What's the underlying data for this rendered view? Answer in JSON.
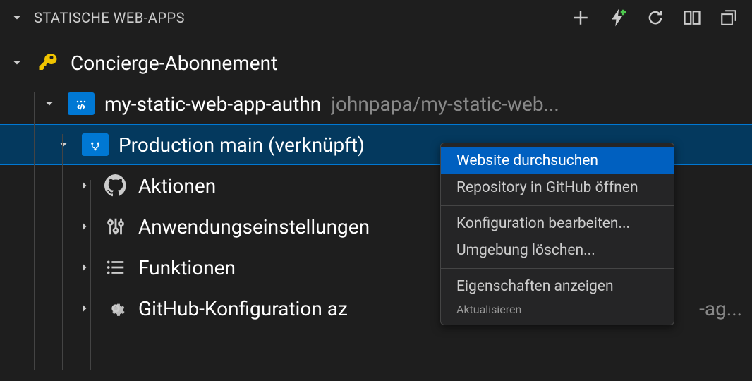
{
  "header": {
    "title": "STATISCHE WEB-APPS"
  },
  "tree": {
    "subscription": "Concierge-Abonnement",
    "app_name": "my-static-web-app-authn",
    "repo": "johnpapa/my-static-web...",
    "environment": "Production main (verknüpft)",
    "children": {
      "actions": "Aktionen",
      "app_settings": "Anwendungseinstellungen",
      "functions": "Funktionen",
      "github_config": "GitHub-Konfiguration az"
    }
  },
  "context_menu": {
    "browse": "Website durchsuchen",
    "open_github": "Repository in GitHub öffnen",
    "edit_config": "Konfiguration bearbeiten...",
    "delete_env": "Umgebung löschen...",
    "properties": "Eigenschaften anzeigen",
    "refresh": "Aktualisieren"
  },
  "truncated_right": "-ag..."
}
